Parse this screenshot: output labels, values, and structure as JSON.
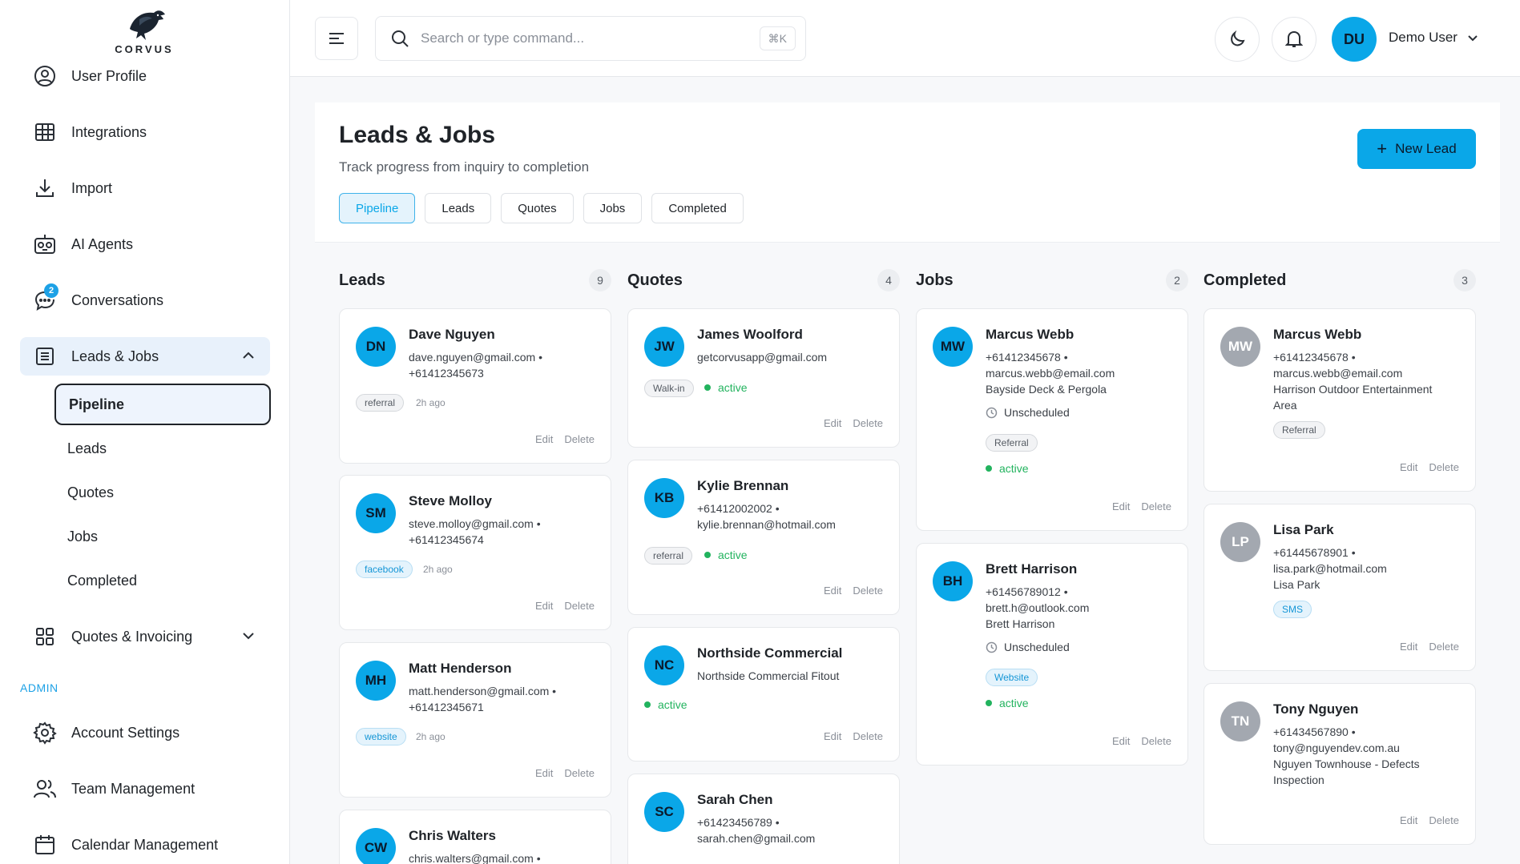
{
  "brand": {
    "name": "CORVUS"
  },
  "sidebar": {
    "items": [
      {
        "label": "User Profile"
      },
      {
        "label": "Integrations"
      },
      {
        "label": "Import"
      },
      {
        "label": "AI Agents"
      },
      {
        "label": "Conversations",
        "badge": "2"
      },
      {
        "label": "Leads & Jobs"
      },
      {
        "label": "Quotes & Invoicing"
      }
    ],
    "subitems": [
      {
        "label": "Pipeline"
      },
      {
        "label": "Leads"
      },
      {
        "label": "Quotes"
      },
      {
        "label": "Jobs"
      },
      {
        "label": "Completed"
      }
    ],
    "admin_label": "ADMIN",
    "admin_items": [
      {
        "label": "Account Settings"
      },
      {
        "label": "Team Management"
      },
      {
        "label": "Calendar Management"
      }
    ]
  },
  "header": {
    "search_placeholder": "Search or type command...",
    "shortcut": "⌘K",
    "user_initials": "DU",
    "user_name": "Demo User"
  },
  "page": {
    "title": "Leads & Jobs",
    "subtitle": "Track progress from inquiry to completion",
    "new_lead_label": "New Lead",
    "tabs": [
      "Pipeline",
      "Leads",
      "Quotes",
      "Jobs",
      "Completed"
    ]
  },
  "actions": {
    "edit": "Edit",
    "delete": "Delete"
  },
  "columns": [
    {
      "title": "Leads",
      "count": "9",
      "cards": [
        {
          "initials": "DN",
          "name": "Dave Nguyen",
          "lines": [
            "dave.nguyen@gmail.com •",
            "+61412345673"
          ],
          "chip": "referral",
          "time": "2h ago"
        },
        {
          "initials": "SM",
          "name": "Steve Molloy",
          "lines": [
            "steve.molloy@gmail.com •",
            "+61412345674"
          ],
          "chip": "facebook",
          "time": "2h ago"
        },
        {
          "initials": "MH",
          "name": "Matt Henderson",
          "lines": [
            "matt.henderson@gmail.com •",
            "+61412345671"
          ],
          "chip": "website",
          "time": "2h ago"
        },
        {
          "initials": "CW",
          "name": "Chris Walters",
          "lines": [
            "chris.walters@gmail.com •"
          ]
        }
      ]
    },
    {
      "title": "Quotes",
      "count": "4",
      "cards": [
        {
          "initials": "JW",
          "name": "James Woolford",
          "lines": [
            "getcorvusapp@gmail.com"
          ],
          "chip": "Walk-in",
          "status": "active"
        },
        {
          "initials": "KB",
          "name": "Kylie Brennan",
          "lines": [
            "+61412002002 •",
            "kylie.brennan@hotmail.com"
          ],
          "chip": "referral",
          "status": "active"
        },
        {
          "initials": "NC",
          "name": "Northside Commercial",
          "lines": [
            "Northside Commercial Fitout"
          ],
          "status": "active"
        },
        {
          "initials": "SC",
          "name": "Sarah Chen",
          "lines": [
            "+61423456789 •",
            "sarah.chen@gmail.com"
          ]
        }
      ]
    },
    {
      "title": "Jobs",
      "count": "2",
      "cards": [
        {
          "initials": "MW",
          "name": "Marcus Webb",
          "lines": [
            "+61412345678 •",
            "marcus.webb@email.com",
            "Bayside Deck & Pergola"
          ],
          "schedule": "Unscheduled",
          "chip": "Referral",
          "status": "active"
        },
        {
          "initials": "BH",
          "name": "Brett Harrison",
          "lines": [
            "+61456789012 •",
            "brett.h@outlook.com",
            "Brett Harrison"
          ],
          "schedule": "Unscheduled",
          "chip": "Website",
          "status": "active"
        }
      ]
    },
    {
      "title": "Completed",
      "count": "3",
      "cards": [
        {
          "initials": "MW",
          "name": "Marcus Webb",
          "lines": [
            "+61412345678 •",
            "marcus.webb@email.com",
            "Harrison Outdoor Entertainment",
            "Area"
          ],
          "chip": "Referral"
        },
        {
          "initials": "LP",
          "name": "Lisa Park",
          "lines": [
            "+61445678901 •",
            "lisa.park@hotmail.com",
            "Lisa Park"
          ],
          "chip": "SMS"
        },
        {
          "initials": "TN",
          "name": "Tony Nguyen",
          "lines": [
            "+61434567890 •",
            "tony@nguyendev.com.au",
            "Nguyen Townhouse - Defects",
            "Inspection"
          ]
        }
      ]
    }
  ]
}
